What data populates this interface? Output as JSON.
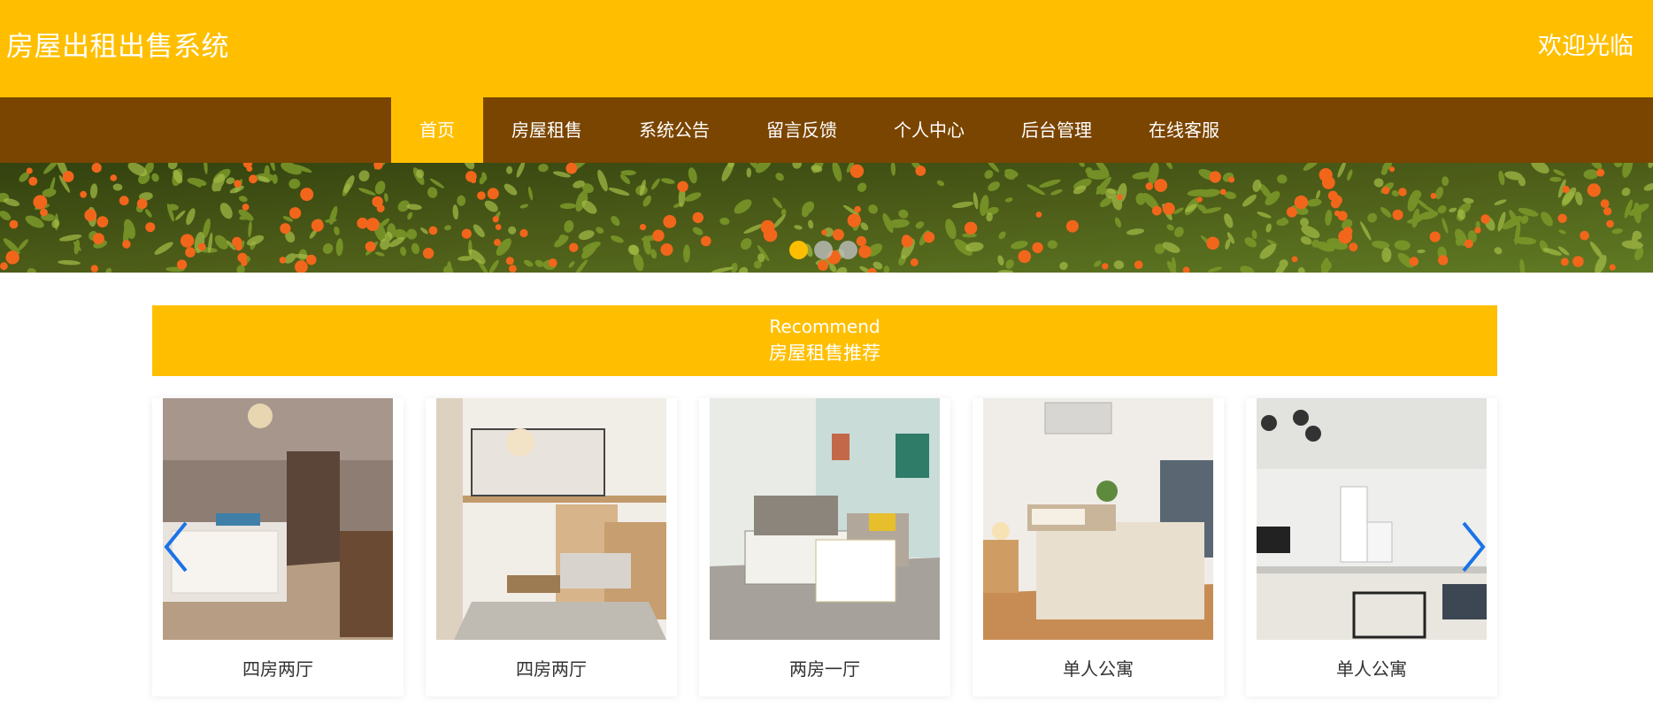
{
  "header": {
    "title": "房屋出租出售系统",
    "welcome": "欢迎光临"
  },
  "nav": {
    "items": [
      {
        "label": "首页",
        "active": true
      },
      {
        "label": "房屋租售",
        "active": false
      },
      {
        "label": "系统公告",
        "active": false
      },
      {
        "label": "留言反馈",
        "active": false
      },
      {
        "label": "个人中心",
        "active": false
      },
      {
        "label": "后台管理",
        "active": false
      },
      {
        "label": "在线客服",
        "active": false
      }
    ]
  },
  "carousel": {
    "slide_count": 3,
    "active_index": 0
  },
  "recommend": {
    "title_en": "Recommend",
    "title_cn": "房屋租售推荐",
    "cards": [
      {
        "name": "四房两厅"
      },
      {
        "name": "四房两厅"
      },
      {
        "name": "两房一厅"
      },
      {
        "name": "单人公寓"
      },
      {
        "name": "单人公寓"
      }
    ]
  },
  "colors": {
    "accent": "#ffbf00",
    "nav_bg": "#7a4500",
    "arrow": "#1a73e8"
  },
  "icons": {
    "prev": "chevron-left-icon",
    "next": "chevron-right-icon"
  }
}
